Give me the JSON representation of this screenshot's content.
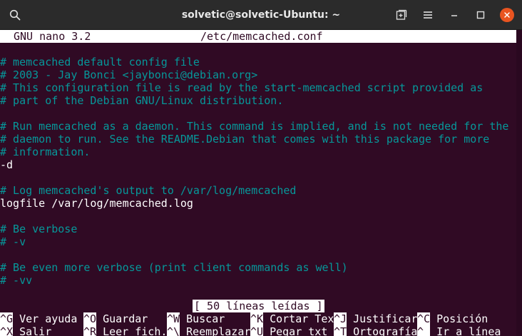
{
  "window": {
    "title": "solvetic@solvetic-Ubuntu: ~",
    "icons": [
      "search-icon",
      "new-tab-icon",
      "menu-icon",
      "minimize-icon",
      "maximize-icon",
      "close-icon"
    ],
    "accent_color": "#e95420"
  },
  "terminal": {
    "background": "#300a24",
    "comment_color": "#06989a",
    "text_color": "#ffffff"
  },
  "nano": {
    "version": "GNU nano 3.2",
    "filename": "/etc/memcached.conf",
    "lines": [
      {
        "text": "# memcached default config file",
        "type": "comment"
      },
      {
        "text": "# 2003 - Jay Bonci <jaybonci@debian.org>",
        "type": "comment"
      },
      {
        "text": "# This configuration file is read by the start-memcached script provided as",
        "type": "comment"
      },
      {
        "text": "# part of the Debian GNU/Linux distribution.",
        "type": "comment"
      },
      {
        "text": "",
        "type": "code"
      },
      {
        "text": "# Run memcached as a daemon. This command is implied, and is not needed for the",
        "type": "comment"
      },
      {
        "text": "# daemon to run. See the README.Debian that comes with this package for more",
        "type": "comment"
      },
      {
        "text": "# information.",
        "type": "comment"
      },
      {
        "text": "-d",
        "type": "code"
      },
      {
        "text": "",
        "type": "code"
      },
      {
        "text": "# Log memcached's output to /var/log/memcached",
        "type": "comment"
      },
      {
        "text": "logfile /var/log/memcached.log",
        "type": "code"
      },
      {
        "text": "",
        "type": "code"
      },
      {
        "text": "# Be verbose",
        "type": "comment"
      },
      {
        "text": "# -v",
        "type": "comment"
      },
      {
        "text": "",
        "type": "code"
      },
      {
        "text": "# Be even more verbose (print client commands as well)",
        "type": "comment"
      },
      {
        "text": "# -vv",
        "type": "comment"
      }
    ],
    "status": "[ 50 líneas leídas ]",
    "shortcuts_row1": [
      {
        "key": "^G",
        "label": " Ver ayuda"
      },
      {
        "key": "^O",
        "label": " Guardar"
      },
      {
        "key": "^W",
        "label": " Buscar"
      },
      {
        "key": "^K",
        "label": " Cortar Tex"
      },
      {
        "key": "^J",
        "label": " Justificar"
      },
      {
        "key": "^C",
        "label": " Posición"
      }
    ],
    "shortcuts_row2": [
      {
        "key": "^X",
        "label": " Salir"
      },
      {
        "key": "^R",
        "label": " Leer fich."
      },
      {
        "key": "^\\",
        "label": " Reemplazar"
      },
      {
        "key": "^U",
        "label": " Pegar txt"
      },
      {
        "key": "^T",
        "label": " Ortografía"
      },
      {
        "key": "^_",
        "label": " Ir a línea"
      }
    ]
  }
}
